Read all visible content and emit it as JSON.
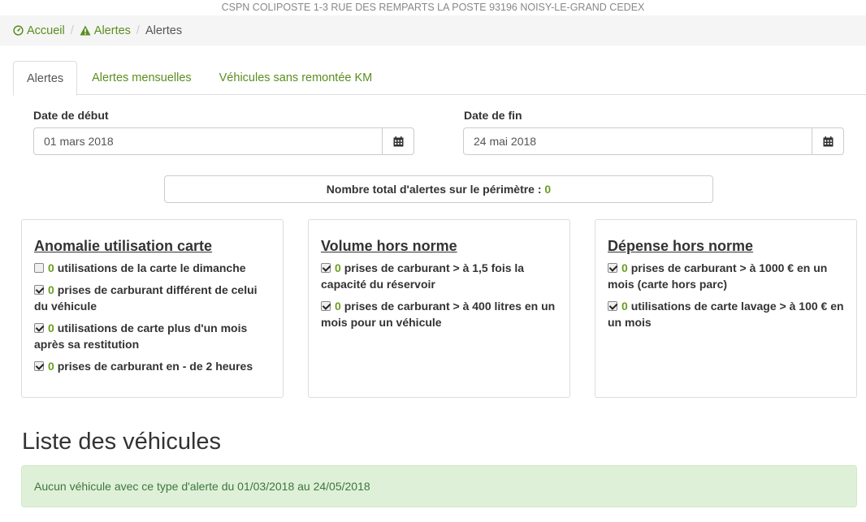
{
  "header": {
    "address": "CSPN COLIPOSTE 1-3 RUE DES REMPARTS LA POSTE 93196 NOISY-LE-GRAND CEDEX"
  },
  "breadcrumb": {
    "home": "Accueil",
    "alerts": "Alertes",
    "current": "Alertes"
  },
  "tabs": [
    {
      "label": "Alertes"
    },
    {
      "label": "Alertes mensuelles"
    },
    {
      "label": "Véhicules sans remontée KM"
    }
  ],
  "filters": {
    "start_label": "Date de début",
    "start_value": "01 mars 2018",
    "end_label": "Date de fin",
    "end_value": "24 mai 2018"
  },
  "total": {
    "label": "Nombre total d'alertes sur le périmètre : ",
    "count": "0"
  },
  "panels": [
    {
      "title": "Anomalie utilisation carte",
      "items": [
        {
          "count": "0",
          "text": "utilisations de la carte le dimanche",
          "checked": false
        },
        {
          "count": "0",
          "text": "prises de carburant différent de celui du véhicule",
          "checked": true
        },
        {
          "count": "0",
          "text": "utilisations de carte plus d'un mois après sa restitution",
          "checked": true
        },
        {
          "count": "0",
          "text": "prises de carburant en - de 2 heures",
          "checked": true
        }
      ]
    },
    {
      "title": "Volume hors norme",
      "items": [
        {
          "count": "0",
          "text": "prises de carburant > à 1,5 fois la capacité du réservoir",
          "checked": true
        },
        {
          "count": "0",
          "text": "prises de carburant > à 400 litres en un mois pour un véhicule",
          "checked": true
        }
      ]
    },
    {
      "title": "Dépense hors norme",
      "items": [
        {
          "count": "0",
          "text": "prises de carburant > à 1000 € en un mois (carte hors parc)",
          "checked": true
        },
        {
          "count": "0",
          "text": "utilisations de carte lavage > à 100 € en un mois",
          "checked": true
        }
      ]
    }
  ],
  "vehicles": {
    "title": "Liste des véhicules",
    "empty_message": "Aucun véhicule avec ce type d'alerte du 01/03/2018 au 24/05/2018"
  },
  "colors": {
    "accent": "#6b9e1f",
    "link": "#5a8e1e",
    "success_bg": "#dff0d8",
    "success_text": "#3c763d"
  }
}
